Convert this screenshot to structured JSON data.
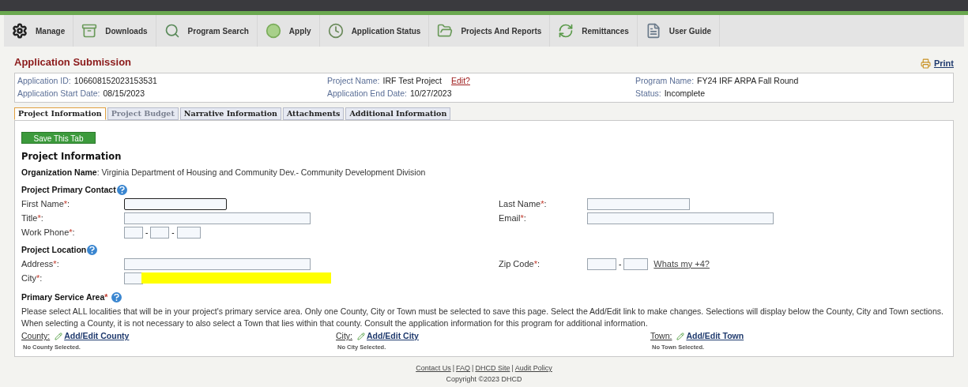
{
  "nav": [
    {
      "label": "Manage"
    },
    {
      "label": "Downloads"
    },
    {
      "label": "Program Search"
    },
    {
      "label": "Apply"
    },
    {
      "label": "Application Status"
    },
    {
      "label": "Projects And Reports"
    },
    {
      "label": "Remittances"
    },
    {
      "label": "User Guide"
    }
  ],
  "page_title": "Application Submission",
  "print_link": "Print",
  "summary": [
    {
      "label": "Application ID:",
      "value": "106608152023153531"
    },
    {
      "label": "Project Name:",
      "value": "IRF Test Project",
      "link": "Edit?"
    },
    {
      "label": "Program Name:",
      "value": "FY24 IRF ARPA Fall Round"
    },
    {
      "label": "Application Start Date:",
      "value": "08/15/2023"
    },
    {
      "label": "Application End Date:",
      "value": "10/27/2023"
    },
    {
      "label": "Status:",
      "value": "Incomplete"
    }
  ],
  "tabs": [
    {
      "label": "Project Information",
      "selected": true,
      "disabled": false
    },
    {
      "label": "Project Budget",
      "selected": false,
      "disabled": true
    },
    {
      "label": "Narrative Information",
      "selected": false,
      "disabled": false
    },
    {
      "label": "Attachments",
      "selected": false,
      "disabled": false
    },
    {
      "label": "Additional Information",
      "selected": false,
      "disabled": false
    }
  ],
  "save_button": "Save This Tab",
  "section_title": "Project Information",
  "organization": {
    "label": "Organization Name",
    "value": ": Virginia Department of Housing and Community Dev.- Community Development Division"
  },
  "groups": [
    {
      "title": "Project Primary Contact",
      "rows": [
        {
          "left": {
            "label": "First Name",
            "kind": "short_text",
            "focused": true
          },
          "right": {
            "label": "Last Name",
            "kind": "short_text",
            "focused": false
          }
        },
        {
          "left": {
            "label": "Title",
            "kind": "long_text",
            "focused": false
          },
          "right": {
            "label": "Email",
            "kind": "long_text",
            "focused": false
          }
        },
        {
          "left": {
            "label": "Work Phone",
            "kind": "phone",
            "separator": "-",
            "focused": false
          }
        }
      ]
    },
    {
      "title": "Project Location",
      "rows": [
        {
          "left": {
            "label": "Address",
            "kind": "long_text",
            "focused": false
          },
          "right": {
            "label": "Zip Code",
            "kind": "zip",
            "separator": "-",
            "link": "Whats my +4?",
            "focused": false
          }
        },
        {
          "left": {
            "label": "City",
            "kind": "redacted",
            "focused": false
          }
        }
      ]
    }
  ],
  "required_mark": "*",
  "label_suffix": ":",
  "service_area": {
    "title": "Primary Service Area",
    "text": "Please select ALL localities that will be in your project's primary service area. Only one County, City or Town must be selected to save this page. Select the Add/Edit link to make changes. Selections will display below the County, City and Town sections. When selecting a County, it is not necessary to also select a Town that lies within that county. Consult the application information for this program for additional information.",
    "localities": [
      {
        "label": "County:",
        "link": "Add/Edit County",
        "note": "No County Selected."
      },
      {
        "label": "City:",
        "link": "Add/Edit City",
        "note": "No City Selected."
      },
      {
        "label": "Town:",
        "link": "Add/Edit Town",
        "note": "No Town Selected."
      }
    ]
  },
  "footer": {
    "items": [
      {
        "kind": "link",
        "text": "Contact Us"
      },
      {
        "kind": "separator",
        "text": "|"
      },
      {
        "kind": "link",
        "text": "FAQ"
      },
      {
        "kind": "separator",
        "text": "|"
      },
      {
        "kind": "link",
        "text": "DHCD Site"
      },
      {
        "kind": "separator",
        "text": "|"
      },
      {
        "kind": "link",
        "text": "Audit Policy"
      }
    ],
    "copyright": "Copyright ©2023 DHCD"
  }
}
